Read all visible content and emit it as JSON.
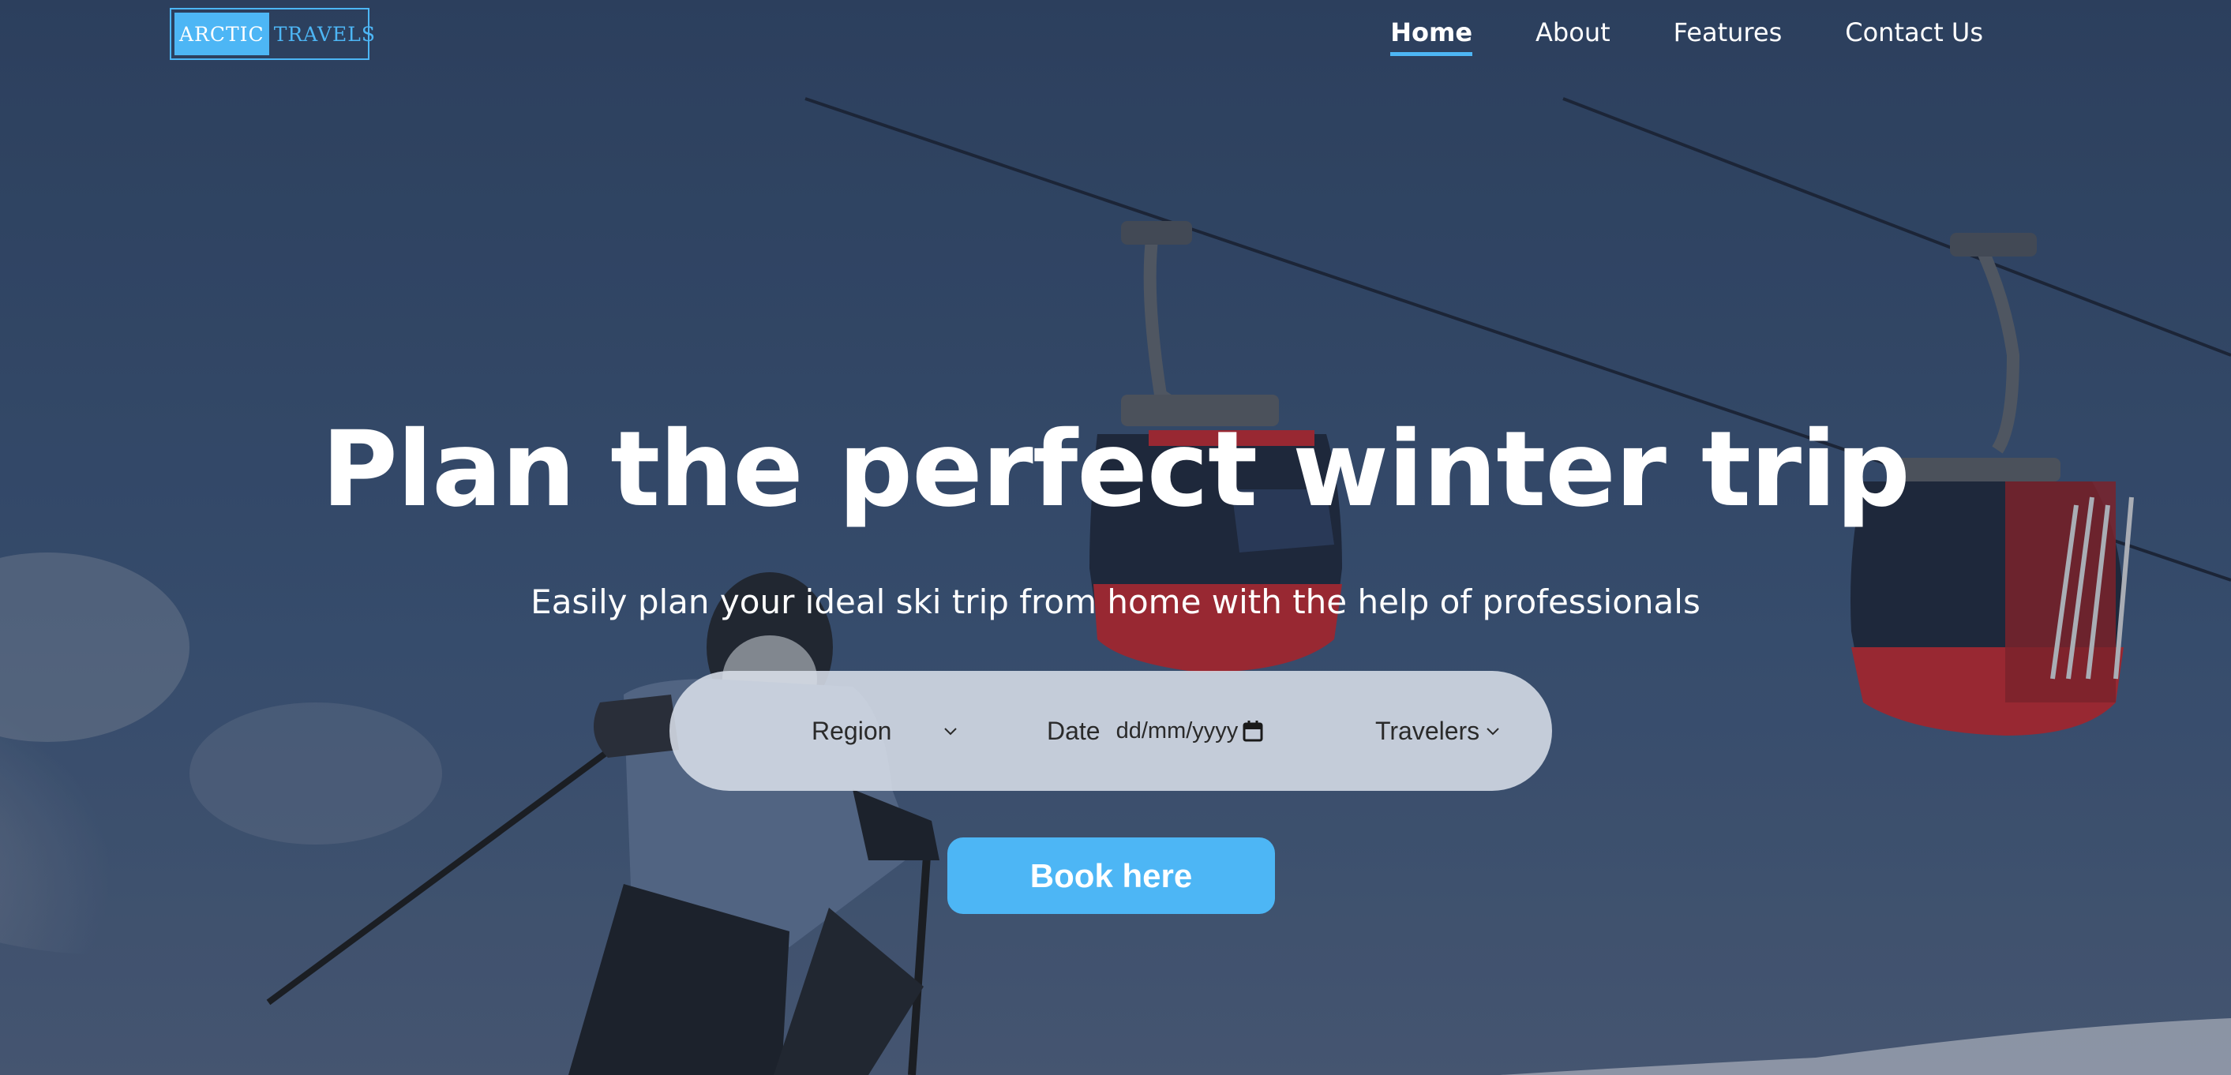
{
  "logo": {
    "left_text": "ARCTIC",
    "right_text": "TRAVELS"
  },
  "nav": {
    "items": [
      {
        "label": "Home",
        "active": true
      },
      {
        "label": "About",
        "active": false
      },
      {
        "label": "Features",
        "active": false
      },
      {
        "label": "Contact Us",
        "active": false
      }
    ]
  },
  "hero": {
    "title": "Plan the perfect winter trip",
    "subtitle": "Easily plan your ideal ski trip from home with the help of professionals",
    "background": "ski-slope-with-red-gondolas-and-skier-photo"
  },
  "search": {
    "region_label": "Region",
    "date_label": "Date",
    "date_placeholder": "dd/mm/yyyy",
    "travelers_label": "Travelers"
  },
  "book_button": {
    "label": "Book here"
  },
  "colors": {
    "accent": "#4db6f5",
    "text": "#ffffff",
    "search_bg": "#d7dee8"
  },
  "icons": {
    "region_dropdown": "chevron-down-icon",
    "travelers_dropdown": "chevron-down-icon",
    "date_picker": "calendar-icon"
  }
}
